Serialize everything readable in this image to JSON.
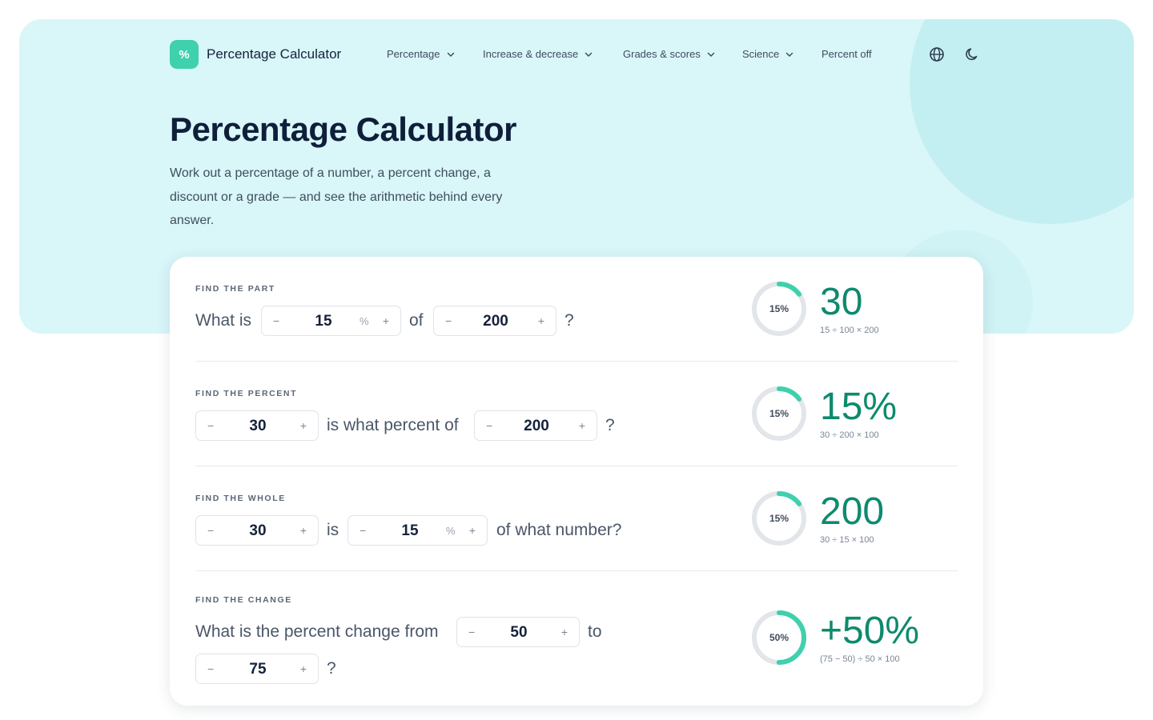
{
  "header": {
    "logo_glyph": "%",
    "brand": "Percentage Calculator",
    "nav": [
      {
        "label": "Percentage",
        "has_menu": true
      },
      {
        "label": "Increase & decrease",
        "has_menu": true
      },
      {
        "label": "Grades & scores",
        "has_menu": true
      },
      {
        "label": "Science",
        "has_menu": true
      },
      {
        "label": "Percent off",
        "has_menu": false
      }
    ],
    "icons": [
      "globe-icon",
      "moon-icon"
    ]
  },
  "hero": {
    "title": "Percentage Calculator",
    "subtitle": "Work out a percentage of a number, a percent change, a discount or a grade — and see the arithmetic behind every answer."
  },
  "calculators": {
    "part": {
      "eyebrow": "FIND THE PART",
      "t1": "What is",
      "t2": "of",
      "t3": "?",
      "percent": "15",
      "whole": "200",
      "ring_label": "15%",
      "ring_fraction": 0.15,
      "result": "30",
      "formula": "15 ÷ 100 × 200"
    },
    "percent": {
      "eyebrow": "FIND THE PERCENT",
      "t1": "is what percent of",
      "t2": "?",
      "part": "30",
      "whole": "200",
      "ring_label": "15%",
      "ring_fraction": 0.15,
      "result": "15%",
      "formula": "30 ÷ 200 × 100"
    },
    "whole": {
      "eyebrow": "FIND THE WHOLE",
      "t1": "is",
      "t2": "of what number?",
      "part": "30",
      "percent": "15",
      "ring_label": "15%",
      "ring_fraction": 0.15,
      "result": "200",
      "formula": "30 ÷ 15 × 100"
    },
    "change": {
      "eyebrow": "FIND THE CHANGE",
      "t1": "What is the percent change from",
      "t2": "to",
      "t3": "?",
      "from": "50",
      "to": "75",
      "ring_label": "50%",
      "ring_fraction": 0.5,
      "result": "+50%",
      "formula": "(75 − 50) ÷ 50 × 100"
    }
  },
  "controls": {
    "minus": "−",
    "plus": "+",
    "percent_sign": "%"
  },
  "colors": {
    "accent": "#3fd0ad",
    "result": "#0e8a6e",
    "hero_bg": "#d9f6f9",
    "ring_track": "#e2e5e9"
  }
}
